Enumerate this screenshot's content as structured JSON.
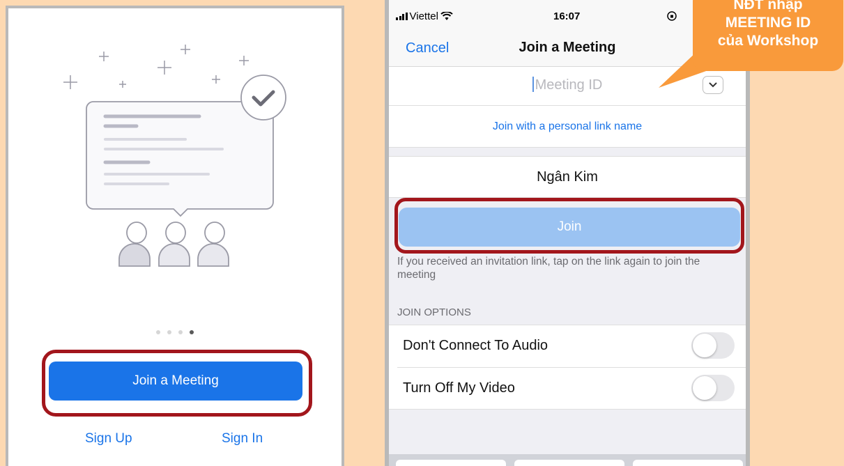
{
  "left_screen": {
    "carousel_dots": 4,
    "carousel_active_index": 3,
    "join_button": "Join a Meeting",
    "sign_up": "Sign Up",
    "sign_in": "Sign In"
  },
  "status_bar": {
    "carrier": "Viettel",
    "time": "16:07",
    "icons": [
      "signal-bars-icon",
      "wifi-icon",
      "screen-rotation-lock-icon"
    ]
  },
  "right_screen": {
    "nav": {
      "cancel": "Cancel",
      "title": "Join a Meeting"
    },
    "meeting_id": {
      "placeholder": "Meeting ID",
      "value": ""
    },
    "personal_link": "Join with a personal link name",
    "display_name": "Ngân Kim",
    "join_button": "Join",
    "hint": "If you received an invitation link, tap on the link again to join the meeting",
    "section_header": "JOIN OPTIONS",
    "options": [
      {
        "label": "Don't Connect To Audio",
        "on": false
      },
      {
        "label": "Turn Off My Video",
        "on": false
      }
    ]
  },
  "callout": {
    "lines": [
      "NĐT nhập",
      "MEETING ID",
      "của Workshop"
    ]
  },
  "colors": {
    "background": "#fdd9b2",
    "zoom_blue": "#1a74e8",
    "join_disabled": "#9bc3f2",
    "highlight_red": "#a2161c",
    "callout_orange": "#f99a3b"
  }
}
